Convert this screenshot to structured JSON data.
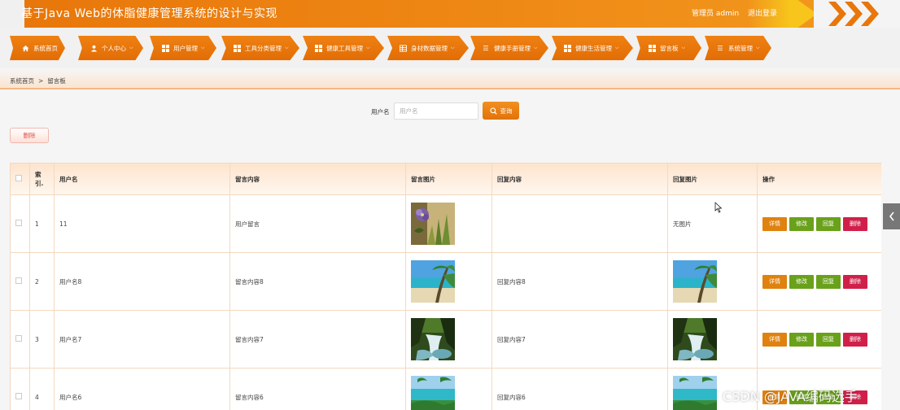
{
  "header": {
    "title": "基于Java Web的体脂健康管理系统的设计与实现",
    "role": "管理员 admin",
    "logout": "退出登录"
  },
  "nav": {
    "items": [
      {
        "label": "系统首页",
        "icon": "home-icon"
      },
      {
        "label": "个人中心",
        "icon": "user-icon"
      },
      {
        "label": "用户管理",
        "icon": "grid-icon"
      },
      {
        "label": "工具分类管理",
        "icon": "grid-icon"
      },
      {
        "label": "健康工具管理",
        "icon": "grid-icon"
      },
      {
        "label": "身材数据管理",
        "icon": "table-icon"
      },
      {
        "label": "健康手册管理",
        "icon": "list-icon"
      },
      {
        "label": "健康生活管理",
        "icon": "grid-icon"
      },
      {
        "label": "留言板",
        "icon": "grid-icon"
      },
      {
        "label": "系统管理",
        "icon": "list-icon"
      }
    ]
  },
  "breadcrumb": {
    "home": "系统首页",
    "separator": ">",
    "current": "留言板"
  },
  "search": {
    "label": "用户名",
    "placeholder": "用户名",
    "button": "查询"
  },
  "delete_button": "删除",
  "table": {
    "headers": [
      "",
      "索引",
      "用户名",
      "留言内容",
      "留言图片",
      "回复内容",
      "回复图片",
      "操作"
    ],
    "index_header_line1": "索",
    "index_header_line2": "引.",
    "rows": [
      {
        "index": "1",
        "username": "11",
        "content": "用户留言",
        "image": "flower",
        "reply": "",
        "reply_image": "无图片"
      },
      {
        "index": "2",
        "username": "用户名8",
        "content": "留言内容8",
        "image": "beach",
        "reply": "回复内容8",
        "reply_image": "beach"
      },
      {
        "index": "3",
        "username": "用户名7",
        "content": "留言内容7",
        "image": "waterfall",
        "reply": "回复内容7",
        "reply_image": "waterfall"
      },
      {
        "index": "4",
        "username": "用户名6",
        "content": "留言内容6",
        "image": "tropical",
        "reply": "回复内容6",
        "reply_image": "tropical"
      }
    ],
    "actions": {
      "detail": "详情",
      "edit": "修改",
      "reply": "回复",
      "delete": "删除"
    }
  },
  "watermark": "CSDN @JAVA编码选手",
  "colors": {
    "accent": "#e8760a",
    "detail": "#e0820f",
    "edit": "#6aa11b",
    "danger": "#d0204a"
  }
}
